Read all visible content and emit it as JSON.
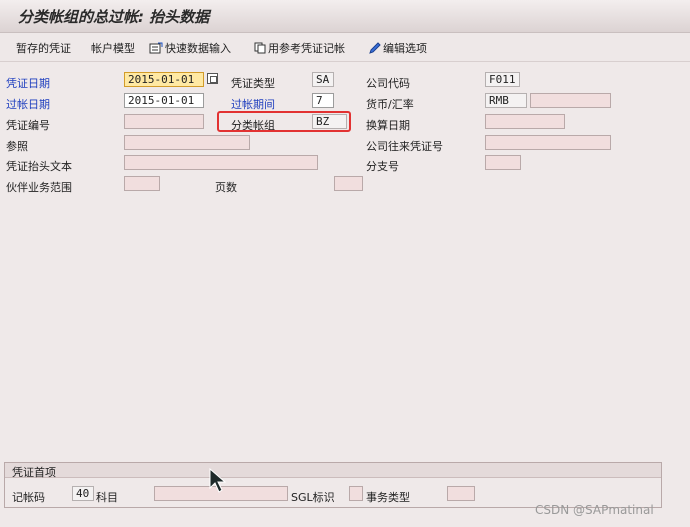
{
  "title": "分类帐组的总过帐: 抬头数据",
  "toolbar": {
    "park": "暂存的凭证",
    "acct_model": "帐户模型",
    "fast_entry": "快速数据输入",
    "ref_doc": "用参考凭证记帐",
    "edit_options": "编辑选项"
  },
  "header": {
    "doc_date_label": "凭证日期",
    "doc_date": "2015-01-01",
    "doc_type_label": "凭证类型",
    "doc_type": "SA",
    "company_code_label": "公司代码",
    "company_code": "F011",
    "posting_date_label": "过帐日期",
    "posting_date": "2015-01-01",
    "period_label": "过帐期间",
    "period": "7",
    "currency_label": "货币/汇率",
    "currency": "RMB",
    "doc_number_label": "凭证编号",
    "ledger_group_label": "分类帐组",
    "ledger_group": "BZ",
    "translation_date_label": "换算日期",
    "reference_label": "参照",
    "cc_doc_label": "公司往来凭证号",
    "header_text_label": "凭证抬头文本",
    "branch_label": "分支号",
    "partner_ba_label": "伙伴业务范围",
    "pages_label": "页数"
  },
  "first_item": {
    "section_title": "凭证首项",
    "posting_key_label": "记帐码",
    "posting_key": "40",
    "account_label": "科目",
    "sgl_label": "SGL标识",
    "trans_type_label": "事务类型"
  },
  "watermark": "CSDN @SAPmatinal"
}
